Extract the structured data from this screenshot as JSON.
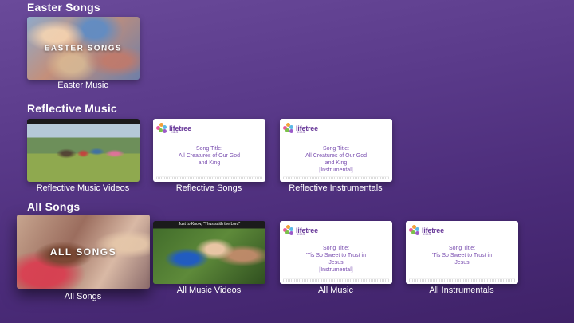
{
  "sections": {
    "easter": {
      "title": "Easter Songs"
    },
    "reflective": {
      "title": "Reflective Music"
    },
    "all": {
      "title": "All Songs"
    }
  },
  "tiles": {
    "easter_music": {
      "overlay": "EASTER SONGS",
      "caption": "Easter Music"
    },
    "reflective_videos": {
      "caption": "Reflective Music Videos"
    },
    "reflective_songs": {
      "logo": "lifetree",
      "logo_sub": "KIDS",
      "song_label": "Song Title:",
      "song_line1": "All Creatures of Our God",
      "song_line2": "and King",
      "song_line3": "",
      "caption": "Reflective Songs"
    },
    "reflective_instrumentals": {
      "logo": "lifetree",
      "logo_sub": "KIDS",
      "song_label": "Song Title:",
      "song_line1": "All Creatures of Our God",
      "song_line2": "and King",
      "song_line3": "[Instrumental]",
      "caption": "Reflective Instrumentals"
    },
    "all_songs": {
      "overlay": "ALL SONGS",
      "caption": "All Songs"
    },
    "all_music_videos": {
      "top_text": "Just to Know, \"Thus saith the Lord\"",
      "caption": "All Music Videos"
    },
    "all_music": {
      "logo": "lifetree",
      "logo_sub": "KIDS",
      "song_label": "Song Title:",
      "song_line1": "'Tis So Sweet to Trust in",
      "song_line2": "Jesus",
      "song_line3": "[Instrumental]",
      "caption": "All Music"
    },
    "all_instrumentals": {
      "logo": "lifetree",
      "logo_sub": "KIDS",
      "song_label": "Song Title:",
      "song_line1": "'Tis So Sweet to Trust in",
      "song_line2": "Jesus",
      "song_line3": "",
      "caption": "All Instrumentals"
    }
  },
  "colors": {
    "background": "#553584",
    "lifetree_purple": "#6a3b9a",
    "song_text": "#7a4fb0",
    "leaf_colors": [
      "#e85a9b",
      "#f2a23a",
      "#5bb8e6",
      "#7bc14a",
      "#9b5ac9"
    ]
  }
}
